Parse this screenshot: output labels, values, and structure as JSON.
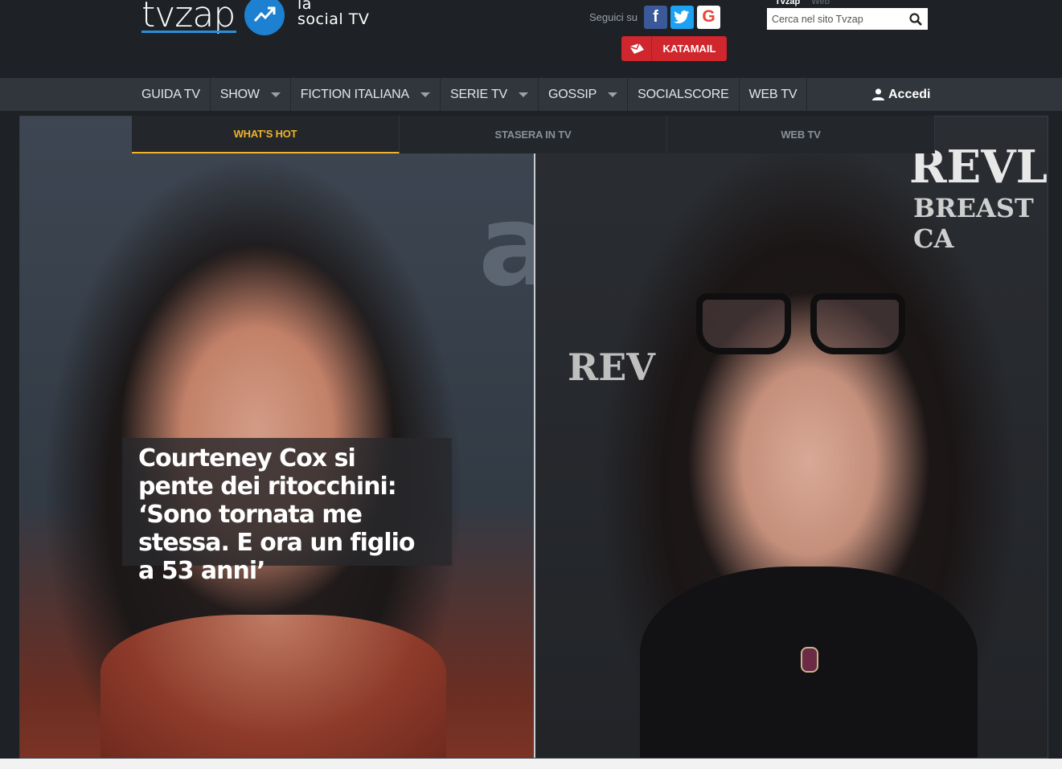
{
  "header": {
    "logo_text": "tvzap",
    "tagline_line1": "la",
    "tagline_line2": "social TV",
    "follow_label": "Seguici su",
    "social": [
      {
        "name": "facebook-icon",
        "glyph": "f"
      },
      {
        "name": "twitter-icon",
        "glyph": "t"
      },
      {
        "name": "google-icon",
        "glyph": "G"
      }
    ],
    "search_tabs": [
      "Tvzap",
      "Web"
    ],
    "search_placeholder": "Cerca nel sito Tvzap",
    "katamail_label": "KATAMAIL"
  },
  "nav": {
    "items": [
      {
        "label": "GUIDA TV",
        "caret": false
      },
      {
        "label": "SHOW",
        "caret": true
      },
      {
        "label": "FICTION ITALIANA",
        "caret": true
      },
      {
        "label": "SERIE TV",
        "caret": true
      },
      {
        "label": "GOSSIP",
        "caret": true
      },
      {
        "label": "SOCIALSCORE",
        "caret": false
      },
      {
        "label": "WEB TV",
        "caret": false
      }
    ],
    "login_label": "Accedi"
  },
  "subtabs": [
    {
      "label": "WHAT'S HOT",
      "active": true
    },
    {
      "label": "STASERA IN TV",
      "active": false
    },
    {
      "label": "WEB TV",
      "active": false
    }
  ],
  "hero": {
    "headline": "Courteney Cox si pente dei ritocchini: ‘Sono tornata me stessa. E ora un figlio a 53 anni’"
  },
  "colors": {
    "accent_yellow": "#f0b429",
    "katamail_red": "#d0262d",
    "brand_blue": "#1e80d0"
  }
}
